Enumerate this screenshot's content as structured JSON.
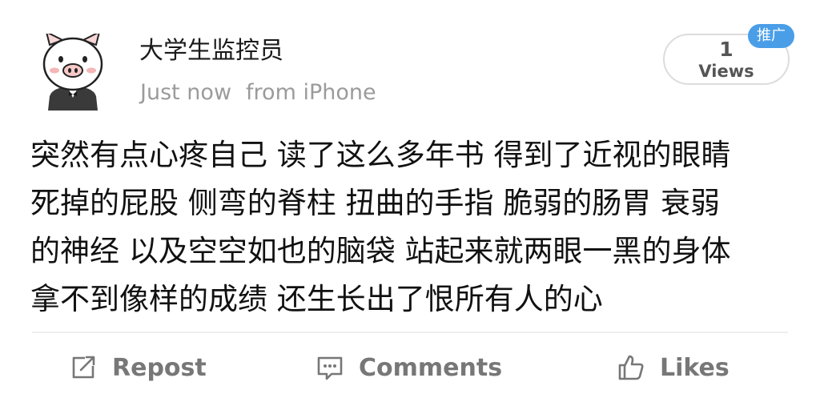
{
  "post": {
    "author": {
      "name": "大学生监控员",
      "avatar_icon": "cartoon-pig-avatar-icon"
    },
    "meta": {
      "time": "Just now",
      "source": "from iPhone"
    },
    "views": {
      "count": "1",
      "label": "Views"
    },
    "promo_badge": "推广",
    "content_lines": [
      "突然有点心疼自己 读了这么多年书 得到了近视的眼睛",
      "死掉的屁股 侧弯的脊柱 扭曲的手指 脆弱的肠胃 衰弱",
      "的神经 以及空空如也的脑袋 站起来就两眼一黑的身体",
      "拿不到像样的成绩 还生长出了恨所有人的心"
    ]
  },
  "actions": {
    "repost": {
      "label": "Repost",
      "icon": "repost-icon"
    },
    "comments": {
      "label": "Comments",
      "icon": "comment-icon"
    },
    "likes": {
      "label": "Likes",
      "icon": "thumbs-up-icon"
    }
  },
  "colors": {
    "badge": "#4a9ee8",
    "meta_text": "#9b9b9b",
    "action_text": "#777777"
  }
}
